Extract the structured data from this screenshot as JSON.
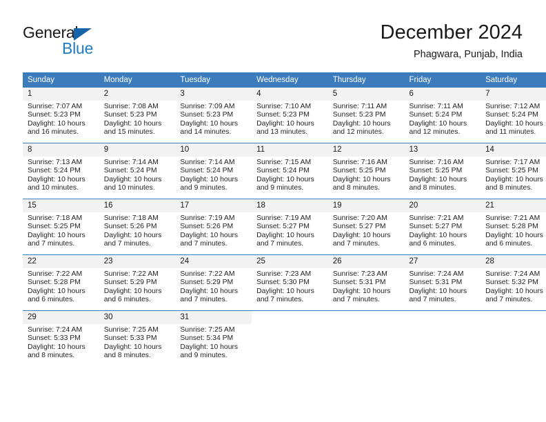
{
  "brand": {
    "name_part1": "General",
    "name_part2": "Blue"
  },
  "header": {
    "title": "December 2024",
    "subtitle": "Phagwara, Punjab, India"
  },
  "weekday_headers": [
    "Sunday",
    "Monday",
    "Tuesday",
    "Wednesday",
    "Thursday",
    "Friday",
    "Saturday"
  ],
  "colors": {
    "header_blue": "#3c7cbd",
    "logo_blue": "#1d7bc4",
    "daynum_bg": "#f2f2f2",
    "text": "#1a1a1a"
  },
  "weeks": [
    [
      {
        "day": "1",
        "sunrise": "Sunrise: 7:07 AM",
        "sunset": "Sunset: 5:23 PM",
        "daylight_line1": "Daylight: 10 hours",
        "daylight_line2": "and 16 minutes."
      },
      {
        "day": "2",
        "sunrise": "Sunrise: 7:08 AM",
        "sunset": "Sunset: 5:23 PM",
        "daylight_line1": "Daylight: 10 hours",
        "daylight_line2": "and 15 minutes."
      },
      {
        "day": "3",
        "sunrise": "Sunrise: 7:09 AM",
        "sunset": "Sunset: 5:23 PM",
        "daylight_line1": "Daylight: 10 hours",
        "daylight_line2": "and 14 minutes."
      },
      {
        "day": "4",
        "sunrise": "Sunrise: 7:10 AM",
        "sunset": "Sunset: 5:23 PM",
        "daylight_line1": "Daylight: 10 hours",
        "daylight_line2": "and 13 minutes."
      },
      {
        "day": "5",
        "sunrise": "Sunrise: 7:11 AM",
        "sunset": "Sunset: 5:23 PM",
        "daylight_line1": "Daylight: 10 hours",
        "daylight_line2": "and 12 minutes."
      },
      {
        "day": "6",
        "sunrise": "Sunrise: 7:11 AM",
        "sunset": "Sunset: 5:24 PM",
        "daylight_line1": "Daylight: 10 hours",
        "daylight_line2": "and 12 minutes."
      },
      {
        "day": "7",
        "sunrise": "Sunrise: 7:12 AM",
        "sunset": "Sunset: 5:24 PM",
        "daylight_line1": "Daylight: 10 hours",
        "daylight_line2": "and 11 minutes."
      }
    ],
    [
      {
        "day": "8",
        "sunrise": "Sunrise: 7:13 AM",
        "sunset": "Sunset: 5:24 PM",
        "daylight_line1": "Daylight: 10 hours",
        "daylight_line2": "and 10 minutes."
      },
      {
        "day": "9",
        "sunrise": "Sunrise: 7:14 AM",
        "sunset": "Sunset: 5:24 PM",
        "daylight_line1": "Daylight: 10 hours",
        "daylight_line2": "and 10 minutes."
      },
      {
        "day": "10",
        "sunrise": "Sunrise: 7:14 AM",
        "sunset": "Sunset: 5:24 PM",
        "daylight_line1": "Daylight: 10 hours",
        "daylight_line2": "and 9 minutes."
      },
      {
        "day": "11",
        "sunrise": "Sunrise: 7:15 AM",
        "sunset": "Sunset: 5:24 PM",
        "daylight_line1": "Daylight: 10 hours",
        "daylight_line2": "and 9 minutes."
      },
      {
        "day": "12",
        "sunrise": "Sunrise: 7:16 AM",
        "sunset": "Sunset: 5:25 PM",
        "daylight_line1": "Daylight: 10 hours",
        "daylight_line2": "and 8 minutes."
      },
      {
        "day": "13",
        "sunrise": "Sunrise: 7:16 AM",
        "sunset": "Sunset: 5:25 PM",
        "daylight_line1": "Daylight: 10 hours",
        "daylight_line2": "and 8 minutes."
      },
      {
        "day": "14",
        "sunrise": "Sunrise: 7:17 AM",
        "sunset": "Sunset: 5:25 PM",
        "daylight_line1": "Daylight: 10 hours",
        "daylight_line2": "and 8 minutes."
      }
    ],
    [
      {
        "day": "15",
        "sunrise": "Sunrise: 7:18 AM",
        "sunset": "Sunset: 5:25 PM",
        "daylight_line1": "Daylight: 10 hours",
        "daylight_line2": "and 7 minutes."
      },
      {
        "day": "16",
        "sunrise": "Sunrise: 7:18 AM",
        "sunset": "Sunset: 5:26 PM",
        "daylight_line1": "Daylight: 10 hours",
        "daylight_line2": "and 7 minutes."
      },
      {
        "day": "17",
        "sunrise": "Sunrise: 7:19 AM",
        "sunset": "Sunset: 5:26 PM",
        "daylight_line1": "Daylight: 10 hours",
        "daylight_line2": "and 7 minutes."
      },
      {
        "day": "18",
        "sunrise": "Sunrise: 7:19 AM",
        "sunset": "Sunset: 5:27 PM",
        "daylight_line1": "Daylight: 10 hours",
        "daylight_line2": "and 7 minutes."
      },
      {
        "day": "19",
        "sunrise": "Sunrise: 7:20 AM",
        "sunset": "Sunset: 5:27 PM",
        "daylight_line1": "Daylight: 10 hours",
        "daylight_line2": "and 7 minutes."
      },
      {
        "day": "20",
        "sunrise": "Sunrise: 7:21 AM",
        "sunset": "Sunset: 5:27 PM",
        "daylight_line1": "Daylight: 10 hours",
        "daylight_line2": "and 6 minutes."
      },
      {
        "day": "21",
        "sunrise": "Sunrise: 7:21 AM",
        "sunset": "Sunset: 5:28 PM",
        "daylight_line1": "Daylight: 10 hours",
        "daylight_line2": "and 6 minutes."
      }
    ],
    [
      {
        "day": "22",
        "sunrise": "Sunrise: 7:22 AM",
        "sunset": "Sunset: 5:28 PM",
        "daylight_line1": "Daylight: 10 hours",
        "daylight_line2": "and 6 minutes."
      },
      {
        "day": "23",
        "sunrise": "Sunrise: 7:22 AM",
        "sunset": "Sunset: 5:29 PM",
        "daylight_line1": "Daylight: 10 hours",
        "daylight_line2": "and 6 minutes."
      },
      {
        "day": "24",
        "sunrise": "Sunrise: 7:22 AM",
        "sunset": "Sunset: 5:29 PM",
        "daylight_line1": "Daylight: 10 hours",
        "daylight_line2": "and 7 minutes."
      },
      {
        "day": "25",
        "sunrise": "Sunrise: 7:23 AM",
        "sunset": "Sunset: 5:30 PM",
        "daylight_line1": "Daylight: 10 hours",
        "daylight_line2": "and 7 minutes."
      },
      {
        "day": "26",
        "sunrise": "Sunrise: 7:23 AM",
        "sunset": "Sunset: 5:31 PM",
        "daylight_line1": "Daylight: 10 hours",
        "daylight_line2": "and 7 minutes."
      },
      {
        "day": "27",
        "sunrise": "Sunrise: 7:24 AM",
        "sunset": "Sunset: 5:31 PM",
        "daylight_line1": "Daylight: 10 hours",
        "daylight_line2": "and 7 minutes."
      },
      {
        "day": "28",
        "sunrise": "Sunrise: 7:24 AM",
        "sunset": "Sunset: 5:32 PM",
        "daylight_line1": "Daylight: 10 hours",
        "daylight_line2": "and 7 minutes."
      }
    ],
    [
      {
        "day": "29",
        "sunrise": "Sunrise: 7:24 AM",
        "sunset": "Sunset: 5:33 PM",
        "daylight_line1": "Daylight: 10 hours",
        "daylight_line2": "and 8 minutes."
      },
      {
        "day": "30",
        "sunrise": "Sunrise: 7:25 AM",
        "sunset": "Sunset: 5:33 PM",
        "daylight_line1": "Daylight: 10 hours",
        "daylight_line2": "and 8 minutes."
      },
      {
        "day": "31",
        "sunrise": "Sunrise: 7:25 AM",
        "sunset": "Sunset: 5:34 PM",
        "daylight_line1": "Daylight: 10 hours",
        "daylight_line2": "and 9 minutes."
      },
      {
        "day": "",
        "sunrise": "",
        "sunset": "",
        "daylight_line1": "",
        "daylight_line2": ""
      },
      {
        "day": "",
        "sunrise": "",
        "sunset": "",
        "daylight_line1": "",
        "daylight_line2": ""
      },
      {
        "day": "",
        "sunrise": "",
        "sunset": "",
        "daylight_line1": "",
        "daylight_line2": ""
      },
      {
        "day": "",
        "sunrise": "",
        "sunset": "",
        "daylight_line1": "",
        "daylight_line2": ""
      }
    ]
  ]
}
